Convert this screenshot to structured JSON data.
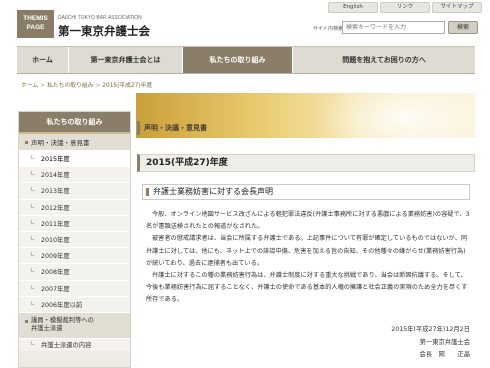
{
  "header": {
    "logo_text": [
      "THEMIS",
      "PAGE"
    ],
    "org_english": "DAIICHI TOKYO BAR ASSOCIATION",
    "org_japanese": "第一東京弁護士会",
    "top_links": [
      "English",
      "リンク",
      "サイトマップ"
    ],
    "search": {
      "label": "サイト内検索",
      "placeholder": "検索キーワードを入力",
      "button_label": "検索"
    }
  },
  "global_nav": [
    "ホーム",
    "第一東京弁護士会とは",
    "私たちの取り組み",
    "問題を抱えてお困りの方へ"
  ],
  "breadcrumb": [
    "ホーム",
    "私たちの取り組み",
    "2015(平成27)年度"
  ],
  "sidebar": {
    "heading": "私たちの取り組み",
    "category": "声明・決議・意見書",
    "years": [
      "2015年度",
      "2014年度",
      "2013年度",
      "2012年度",
      "2011年度",
      "2010年度",
      "2009年度",
      "2008年度",
      "2007年度",
      "2006年度以前"
    ],
    "category2": [
      "議員・模擬裁判等への",
      "弁護士派遣"
    ],
    "sub_item": "弁護士派遣の内容"
  },
  "main": {
    "section_heading": "声明・決議・意見書",
    "year_title": "2015(平成27)年度",
    "article_title": "弁護士業務妨害に対する会長声明",
    "paragraphs": [
      "今般、オンライン地図サービス改ざんによる軽犯罪法違反(弁護士事務所に対する悪戯による業務妨害)の容疑で、3名が書類送検されたとの報道がなされた。",
      "被害者の懲戒請求者は、当会に所属する弁護士である。上記事件について有罪が確定しているものではないが、同弁護士に対しては、他にも、ネット上での誹謗中傷、危害を加える旨の告知、その他種々の嫌がらせ(業務妨害行為)が続いており、過去に逮捕者も出ている。",
      "弁護士に対するこの種の業務妨害行為は、弁護士制度に対する重大な挑戦であり、当会は断固抗議する。そして、今後も業務妨害行為に屈することなく、弁護士の使命である基本的人権の擁護と社会正義の実現のため全力を尽くす所存である。"
    ],
    "date": "2015年(平成27年)12月2日",
    "signer_org": "第一東京弁護士会",
    "signer_name": "会長　岡　　正晶"
  }
}
